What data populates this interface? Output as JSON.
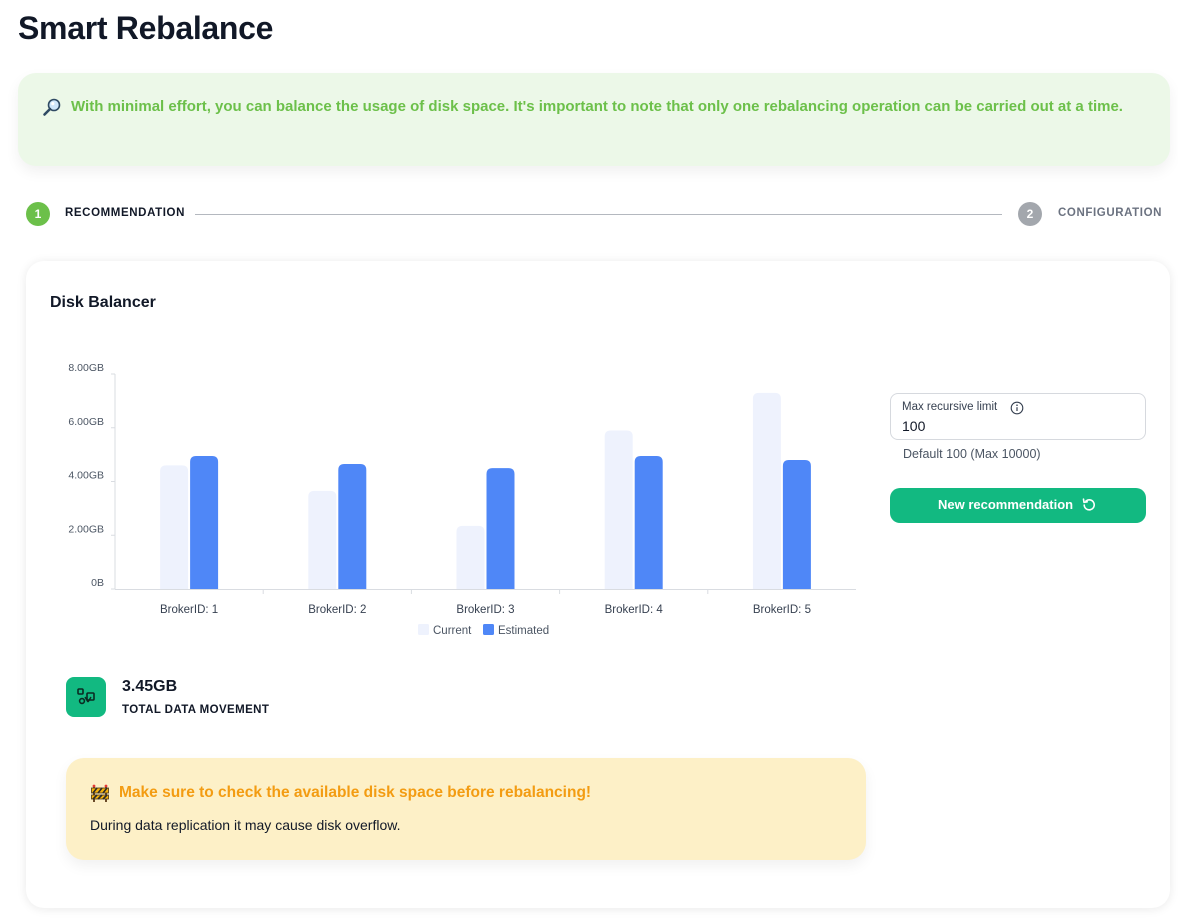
{
  "page": {
    "title": "Smart Rebalance"
  },
  "info_banner": {
    "icon": "magnifier-icon",
    "text": "With minimal effort, you can balance the usage of disk space. It's important to note that only one rebalancing operation can be carried out at a time."
  },
  "stepper": {
    "steps": [
      {
        "number": "1",
        "label": "RECOMMENDATION",
        "state": "active"
      },
      {
        "number": "2",
        "label": "CONFIGURATION",
        "state": "inactive"
      }
    ]
  },
  "card": {
    "title": "Disk Balancer"
  },
  "chart_data": {
    "type": "bar",
    "categories": [
      "BrokerID: 1",
      "BrokerID: 2",
      "BrokerID: 3",
      "BrokerID: 4",
      "BrokerID: 5"
    ],
    "series": [
      {
        "name": "Current",
        "values": [
          4.6,
          3.65,
          2.35,
          5.9,
          7.3
        ],
        "color": "#eef2fd"
      },
      {
        "name": "Estimated",
        "values": [
          4.95,
          4.65,
          4.5,
          4.95,
          4.8
        ],
        "color": "#4f87f7"
      }
    ],
    "yticks": [
      "0B",
      "2.00GB",
      "4.00GB",
      "6.00GB",
      "8.00GB"
    ],
    "ylim": [
      0,
      8
    ],
    "legend_position": "bottom-center",
    "grid": false
  },
  "stat": {
    "icon": "data-movement-icon",
    "value": "3.45GB",
    "label": "TOTAL DATA MOVEMENT"
  },
  "warning": {
    "icon": "construction-barrier-icon",
    "title": "Make sure to check the available disk space before rebalancing!",
    "body": "During data replication it may cause disk overflow."
  },
  "settings": {
    "max_recursive_limit": {
      "label": "Max recursive limit",
      "value": "100",
      "hint": "Default 100 (Max 10000)"
    },
    "new_recommendation_button": {
      "label": "New recommendation",
      "icon": "refresh-icon"
    }
  },
  "colors": {
    "success_green": "#6cc04a",
    "accent_teal": "#12b981",
    "info_bg": "#ecf8e8",
    "warning_bg": "#fdf0c7",
    "warning_text": "#f39c12"
  }
}
